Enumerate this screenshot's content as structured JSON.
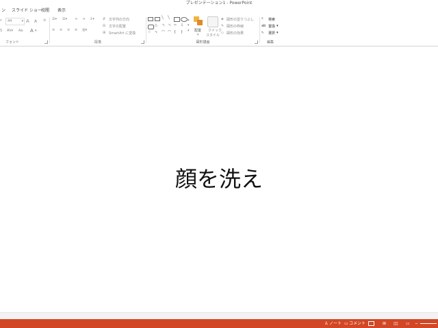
{
  "window": {
    "title": "プレゼンテーション1 - PowerPoint"
  },
  "tabs": [
    {
      "label": "ン"
    },
    {
      "label": "スライド ショー"
    },
    {
      "label": "校閲"
    },
    {
      "label": "表示"
    }
  ],
  "ribbon": {
    "font_group": {
      "label": "フォント",
      "font_size": "44",
      "grow_font": "A",
      "shrink_font": "A",
      "change_case": "Aa",
      "font_color": "A"
    },
    "paragraph_group": {
      "label": "段落",
      "text_direction": "文字列の方向",
      "align_text": "文字の配置",
      "smartart": "SmartArt に変換"
    },
    "drawing_group": {
      "label": "図形描画",
      "arrange": "配置",
      "quick_styles_line1": "クイック",
      "quick_styles_line2": "スタイル",
      "shape_fill": "図形の塗りつぶし",
      "shape_outline": "図形の枠線",
      "shape_effects": "図形の効果"
    },
    "editing_group": {
      "label": "編集",
      "find": "検索",
      "replace": "置換",
      "select": "選択"
    }
  },
  "slide": {
    "text": "顔を洗え"
  },
  "statusbar": {
    "notes": "ノート",
    "comments": "コメント",
    "zoom_minus": "−",
    "accent_color": "#d24726"
  }
}
